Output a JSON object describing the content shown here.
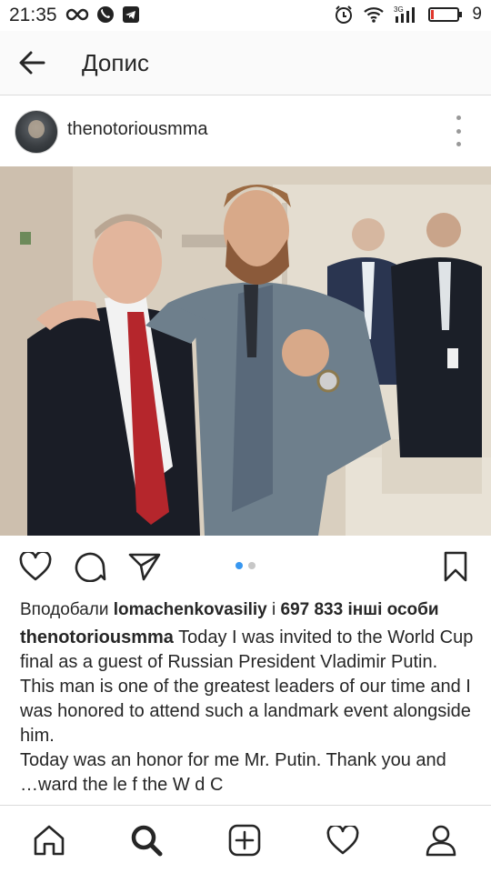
{
  "status_bar": {
    "time": "21:35",
    "battery_level": "9",
    "left_icons": [
      "infinity-icon",
      "viber-icon",
      "telegram-icon"
    ],
    "right_icons": [
      "alarm-icon",
      "wifi-icon",
      "signal-icon",
      "battery-icon"
    ]
  },
  "topbar": {
    "title": "Допис",
    "back_icon": "arrow-left-icon"
  },
  "post": {
    "username": "thenotoriousmma",
    "carousel": {
      "count": 2,
      "active_index": 0
    }
  },
  "likes": {
    "prefix": "Вподобали ",
    "user": "lomachenkovasiliy",
    "middle": " і ",
    "count": "697 833",
    "suffix": " інші особи"
  },
  "caption": {
    "username": "thenotoriousmma",
    "lines": [
      "Today I was invited to the World Cup final as a guest of Russian President Vladimir Putin.",
      "This man is one of the greatest leaders of our time and I was honored to attend such a landmark event alongside him.",
      "Today was an honor for me Mr. Putin. Thank you and",
      "…ward     the    le   f     the W   d C"
    ]
  },
  "colors": {
    "accent": "#3897f0",
    "text": "#262626",
    "divider": "#dbdbdb"
  },
  "nav": {
    "items": [
      "home-icon",
      "search-icon",
      "add-post-icon",
      "activity-heart-icon",
      "profile-icon"
    ]
  }
}
